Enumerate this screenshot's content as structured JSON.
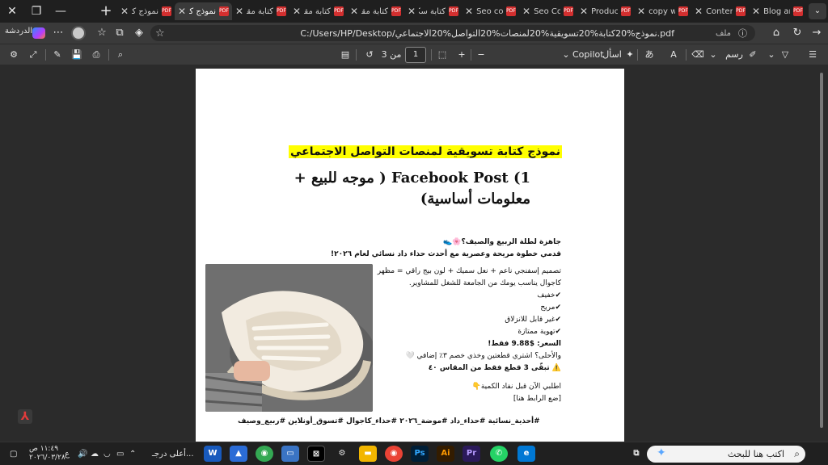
{
  "browser": {
    "tabs": [
      {
        "label": "نموذج كتا",
        "active": true
      },
      {
        "label": "نموذج كت",
        "active": false
      },
      {
        "label": "كتابة مقا",
        "active": false
      },
      {
        "label": "كتابة مقا",
        "active": false
      },
      {
        "label": "كتابة مقا",
        "active": false
      },
      {
        "label": "كتابة سكر",
        "active": false
      },
      {
        "label": "Seo copy",
        "active": false
      },
      {
        "label": "Seo Cont",
        "active": false
      },
      {
        "label": "Product d",
        "active": false
      },
      {
        "label": "copy writ",
        "active": false
      },
      {
        "label": "Content v",
        "active": false
      },
      {
        "label": "Blog artic",
        "active": false
      }
    ],
    "address": {
      "url": "C:/Users/HP/Desktop/نموذج%20كتابة%20تسويقية%20لمنصات%20التواصل%20الاجتماعي.pdf",
      "file_label": "ملف",
      "chat_label": "الدردشة"
    }
  },
  "pdf_toolbar": {
    "copilot_label": "Copilot",
    "ask_label": "اسأل",
    "draw_label": "رسم",
    "page_current": "1",
    "page_total_label": "من 3"
  },
  "document": {
    "heading": "نموذج كتابة تسويقية لمنصات التواصل الاجتماعي",
    "section_title": "1) Facebook Post ( موجه للبيع + معلومات أساسية)",
    "post_lines": [
      {
        "text": "جاهزة لطلة الربيع والصيف؟🌸👟",
        "bold": true
      },
      {
        "text": "قدمي خطوة مريحة وعصرية مع أحدث حذاء داد نسائي لعام ٢٠٢٦!",
        "bold": true
      },
      {
        "text": "",
        "bold": false
      },
      {
        "text": "تصميم إسفنجي ناعم + نعل سميك + لون بيج راقي = مظهر",
        "bold": false
      },
      {
        "text": "كاجوال يناسب يومك من الجامعة للشغل للمشاوير.",
        "bold": false
      },
      {
        "text": "✔خفيف",
        "bold": false
      },
      {
        "text": "✔مريح",
        "bold": false
      },
      {
        "text": "✔غير قابل للانزلاق",
        "bold": false
      },
      {
        "text": "✔تهوية ممتازة",
        "bold": false
      },
      {
        "text": "",
        "bold": false
      },
      {
        "text": "السعر: $9.88 فقط!",
        "bold": false
      },
      {
        "text": "والأحلى؟ اشتري قطعتين وخذي خصم ٣٪ إضافي 🤍",
        "bold": false
      },
      {
        "text": "⚠️ تبقّى 3 قطع فقط من المقاس ٤٠",
        "bold": false
      },
      {
        "text": "",
        "bold": false
      },
      {
        "text": "اطلبي الآن قبل نفاد الكمية👇",
        "bold": false
      },
      {
        "text": "[ضع الرابط هنا]",
        "bold": false
      }
    ],
    "hashtags": "#أحذية_نسائية #حذاء_داد #موضة_٢٠٢٦ #حذاء_كاجوال #تسوق_أونلاين #ربيع_وصيف",
    "image_alt": "حذاء داد نسائي بيج"
  },
  "taskbar": {
    "search_placeholder": "اكتب هنا للبحث",
    "weather_label": "أعلى درجـ...",
    "time": "١١:٤٩ ص",
    "date": "٢٠٢٦/٠٣/٢٨",
    "lang": "ع"
  },
  "colors": {
    "highlight": "#ffff00",
    "accent": "#0078d4",
    "pdf_red": "#d32f2f"
  }
}
